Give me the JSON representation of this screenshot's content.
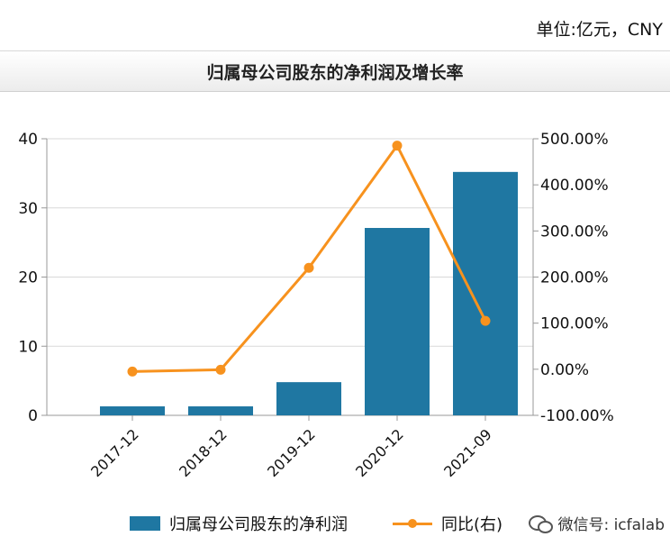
{
  "header": {
    "unit": "单位:亿元，CNY",
    "title": "归属母公司股东的净利润及增长率"
  },
  "chart_data": {
    "type": "bar",
    "categories": [
      "2017-12",
      "2018-12",
      "2019-12",
      "2020-12",
      "2021-09"
    ],
    "series": [
      {
        "name": "归属母公司股东的净利润",
        "type": "bar",
        "axis": "left",
        "values": [
          1.3,
          1.3,
          4.8,
          27.1,
          35.2
        ]
      },
      {
        "name": "同比(右)",
        "type": "line",
        "axis": "right",
        "values": [
          -5.0,
          -1.0,
          220.0,
          485.0,
          105.0
        ]
      }
    ],
    "y_left": {
      "min": 0,
      "max": 40,
      "ticks": [
        0,
        10,
        20,
        30,
        40
      ],
      "tick_labels": [
        "0",
        "10",
        "20",
        "30",
        "40"
      ]
    },
    "y_right": {
      "min": -100,
      "max": 500,
      "ticks": [
        -100,
        0,
        100,
        200,
        300,
        400,
        500
      ],
      "tick_labels": [
        "-100.00%",
        "0.00%",
        "100.00%",
        "200.00%",
        "300.00%",
        "400.00%",
        "500.00%"
      ]
    },
    "grid": true,
    "legend_position": "bottom",
    "colors": {
      "bar": "#1f77a2",
      "line": "#f7921e",
      "grid": "#d9d9d9",
      "axis": "#999999"
    }
  },
  "legend": {
    "bar_label": "归属母公司股东的净利润",
    "line_label": "同比(右)"
  },
  "watermark": {
    "icon": "wechat-icon",
    "text": "微信号: icfalab"
  }
}
